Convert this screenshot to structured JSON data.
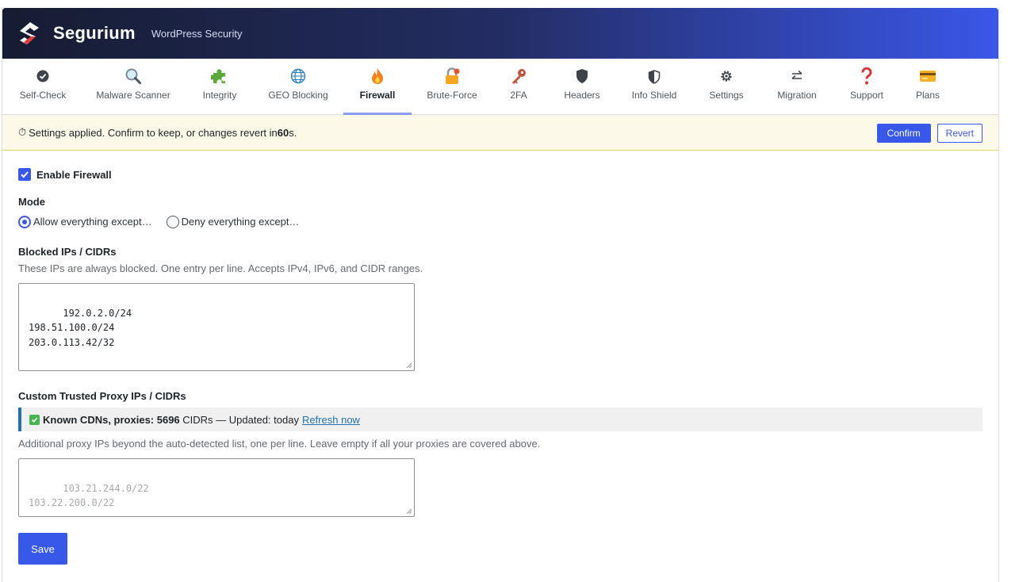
{
  "header": {
    "brand": "Segurium",
    "tagline": "WordPress Security"
  },
  "tabs": [
    {
      "label": "Self-Check",
      "icon": "check-circle-icon"
    },
    {
      "label": "Malware Scanner",
      "icon": "magnifier-icon"
    },
    {
      "label": "Integrity",
      "icon": "puzzle-icon"
    },
    {
      "label": "GEO Blocking",
      "icon": "globe-icon"
    },
    {
      "label": "Firewall",
      "icon": "fire-icon",
      "active": true
    },
    {
      "label": "Brute-Force",
      "icon": "lock-icon"
    },
    {
      "label": "2FA",
      "icon": "key-icon"
    },
    {
      "label": "Headers",
      "icon": "shield-icon"
    },
    {
      "label": "Info Shield",
      "icon": "shield-half-icon"
    },
    {
      "label": "Settings",
      "icon": "gear-icon"
    },
    {
      "label": "Migration",
      "icon": "swap-arrows-icon"
    },
    {
      "label": "Support",
      "icon": "question-icon"
    },
    {
      "label": "Plans",
      "icon": "credit-card-icon"
    }
  ],
  "notice": {
    "prefix": "Settings applied. Confirm to keep, or changes revert in ",
    "seconds": "60",
    "suffix": "s.",
    "confirm": "Confirm",
    "revert": "Revert"
  },
  "firewall": {
    "enable_label": "Enable Firewall",
    "enabled": true,
    "mode_label": "Mode",
    "mode_allow": "Allow everything except…",
    "mode_deny": "Deny everything except…",
    "blocked_label": "Blocked IPs / CIDRs",
    "blocked_desc": "These IPs are always blocked. One entry per line. Accepts IPv4, IPv6, and CIDR ranges.",
    "blocked_value": "192.0.2.0/24\n198.51.100.0/24\n203.0.113.42/32",
    "proxy_label": "Custom Trusted Proxy IPs / CIDRs",
    "cdn_bold": "Known CDNs, proxies: 5696",
    "cdn_rest": " CIDRs — Updated: today",
    "cdn_link": "Refresh now",
    "proxy_desc": "Additional proxy IPs beyond the auto-detected list, one per line. Leave empty if all your proxies are covered above.",
    "proxy_placeholder": "103.21.244.0/22\n103.22.200.0/22",
    "save": "Save"
  },
  "colors": {
    "accent": "#3858e9",
    "notice_bg": "#fcf9e8",
    "link": "#2271b1"
  }
}
